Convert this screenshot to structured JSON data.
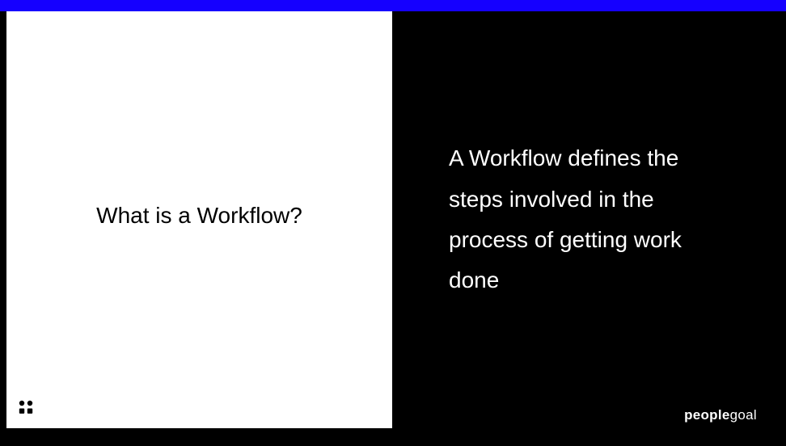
{
  "left": {
    "title": "What is a Workflow?"
  },
  "right": {
    "body": "A Workflow defines the steps involved in the process of getting work done"
  },
  "logo": {
    "bold": "people",
    "light": "goal"
  }
}
